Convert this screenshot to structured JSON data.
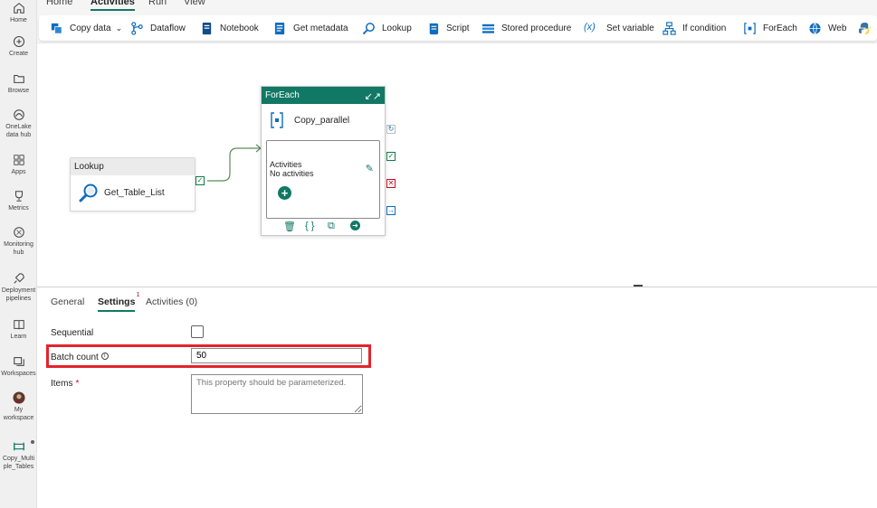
{
  "rail": [
    {
      "id": "home",
      "label": "Home",
      "icon": "home-icon"
    },
    {
      "id": "create",
      "label": "Create",
      "icon": "create-plus-icon"
    },
    {
      "id": "browse",
      "label": "Browse",
      "icon": "folder-icon"
    },
    {
      "id": "onelake",
      "label1": "OneLake",
      "label2": "data hub",
      "icon": "onelake-icon"
    },
    {
      "id": "apps",
      "label": "Apps",
      "icon": "apps-grid-icon"
    },
    {
      "id": "metrics",
      "label": "Metrics",
      "icon": "trophy-icon"
    },
    {
      "id": "monitoring",
      "label1": "Monitoring",
      "label2": "hub",
      "icon": "monitoring-icon"
    },
    {
      "id": "deployment",
      "label1": "Deployment",
      "label2": "pipelines",
      "icon": "rocket-icon"
    },
    {
      "id": "learn",
      "label": "Learn",
      "icon": "book-icon"
    },
    {
      "id": "workspaces",
      "label": "Workspaces",
      "icon": "workspaces-icon"
    },
    {
      "id": "my-workspace",
      "label1": "My",
      "label2": "workspace",
      "icon": "avatar-icon"
    },
    {
      "id": "copy-multi",
      "label1": "Copy_Multi",
      "label2": "ple_Tables",
      "icon": "pipeline-icon"
    }
  ],
  "menu": {
    "home": "Home",
    "activities": "Activities",
    "run": "Run",
    "view": "View"
  },
  "toolbar": {
    "copy_data": "Copy data",
    "dataflow": "Dataflow",
    "notebook": "Notebook",
    "get_metadata": "Get metadata",
    "lookup": "Lookup",
    "script": "Script",
    "stored_procedure": "Stored procedure",
    "set_variable": "Set variable",
    "if_condition": "If condition",
    "foreach": "ForEach",
    "web": "Web"
  },
  "canvas": {
    "lookup_card": {
      "header": "Lookup",
      "name": "Get_Table_List"
    },
    "foreach_card": {
      "header": "ForEach",
      "name": "Copy_parallel",
      "inner_title": "Activities",
      "inner_status": "No activities"
    }
  },
  "panel": {
    "tabs": {
      "general": "General",
      "settings": "Settings",
      "settings_badge": "1",
      "activities": "Activities (0)"
    },
    "sequential_label": "Sequential",
    "batch_count_label": "Batch count",
    "batch_count_value": "50",
    "items_label": "Items",
    "items_placeholder": "This property should be parameterized."
  },
  "colors": {
    "accent": "#117865",
    "highlight": "#e3242b",
    "success": "#107c41",
    "error": "#c50f1f"
  }
}
